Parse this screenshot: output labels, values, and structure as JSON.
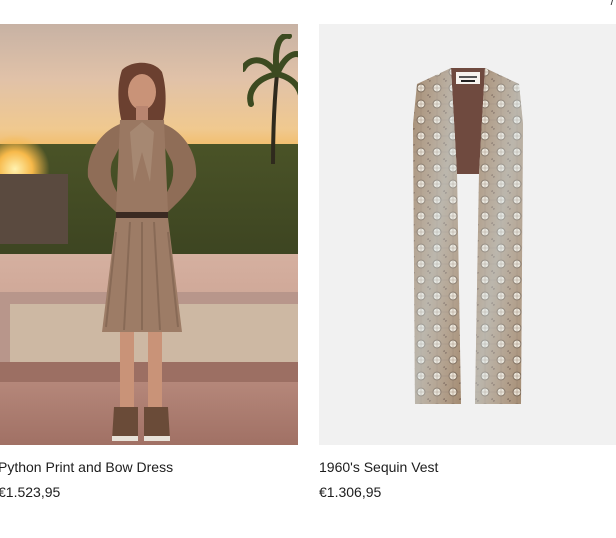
{
  "products": [
    {
      "name": "Python Print and Bow Dress",
      "price": "€1.523,95"
    },
    {
      "name": "1960's Sequin Vest",
      "price": "€1.306,95"
    }
  ],
  "corner_text": "/"
}
